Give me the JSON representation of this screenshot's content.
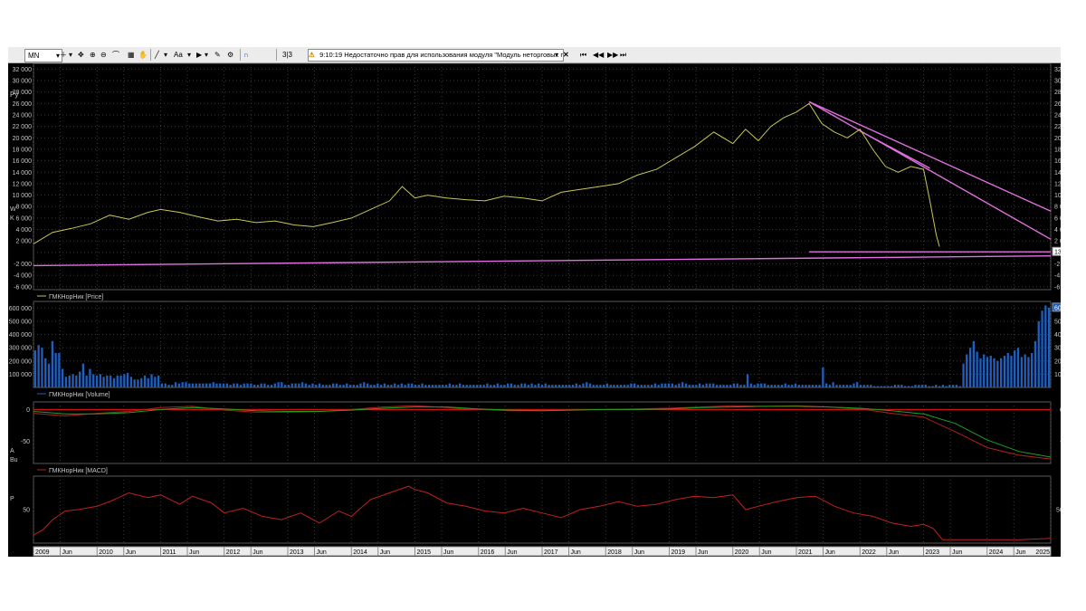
{
  "toolbar": {
    "timeframe": "MN",
    "counter": "3|3",
    "status_time": "9:10:19",
    "status_text": "Недостаточно прав для использования модуля \"Модуль неторговых п",
    "text_tool": "Aa"
  },
  "panes": {
    "price": {
      "legend": "ГМКНорНик [Price]",
      "left_label": "Ру",
      "last_value": "137,18"
    },
    "volume": {
      "legend": "ГМКНорНик [Volume]",
      "last_value": "60 282"
    },
    "macd": {
      "legend": "ГМКНорНик [MACD]"
    },
    "rsi": {
      "legend": "ГМКНорНик [RSI]"
    }
  },
  "time_axis": [
    {
      "label": "2009",
      "v": 2009.0
    },
    {
      "label": "Jun",
      "v": 2009.42
    },
    {
      "label": "2010",
      "v": 2010.0
    },
    {
      "label": "Jun",
      "v": 2010.42
    },
    {
      "label": "2011",
      "v": 2011.0
    },
    {
      "label": "Jun",
      "v": 2011.42
    },
    {
      "label": "2012",
      "v": 2012.0
    },
    {
      "label": "Jun",
      "v": 2012.42
    },
    {
      "label": "2013",
      "v": 2013.0
    },
    {
      "label": "Jun",
      "v": 2013.42
    },
    {
      "label": "2014",
      "v": 2014.0
    },
    {
      "label": "Jun",
      "v": 2014.42
    },
    {
      "label": "2015",
      "v": 2015.0
    },
    {
      "label": "Jun",
      "v": 2015.42
    },
    {
      "label": "2016",
      "v": 2016.0
    },
    {
      "label": "Jun",
      "v": 2016.42
    },
    {
      "label": "2017",
      "v": 2017.0
    },
    {
      "label": "Jun",
      "v": 2017.42
    },
    {
      "label": "2018",
      "v": 2018.0
    },
    {
      "label": "Jun",
      "v": 2018.42
    },
    {
      "label": "2019",
      "v": 2019.0
    },
    {
      "label": "Jun",
      "v": 2019.42
    },
    {
      "label": "2020",
      "v": 2020.0
    },
    {
      "label": "Jun",
      "v": 2020.42
    },
    {
      "label": "2021",
      "v": 2021.0
    },
    {
      "label": "Jun",
      "v": 2021.42
    },
    {
      "label": "2022",
      "v": 2022.0
    },
    {
      "label": "Jun",
      "v": 2022.42
    },
    {
      "label": "2023",
      "v": 2023.0
    },
    {
      "label": "Jun",
      "v": 2023.42
    },
    {
      "label": "2024",
      "v": 2024.0
    },
    {
      "label": "Jun",
      "v": 2024.42
    },
    {
      "label": "2025",
      "v": 2025.0
    }
  ],
  "axes": {
    "price_ticks": [
      "32 000",
      "30 000",
      "28 000",
      "26 000",
      "24 000",
      "22 000",
      "20 000",
      "18 000",
      "16 000",
      "14 000",
      "12 000",
      "10 000",
      "8 000",
      "6 000",
      "4 000",
      "2 000",
      "0",
      "-2 000",
      "-4 000",
      "-6 000"
    ],
    "price_values": [
      32000,
      30000,
      28000,
      26000,
      24000,
      22000,
      20000,
      18000,
      16000,
      14000,
      12000,
      10000,
      8000,
      6000,
      4000,
      2000,
      0,
      -2000,
      -4000,
      -6000
    ],
    "price_left_ticks": [
      "32 000",
      "30 000",
      "28 000",
      "26 000",
      "24 000",
      "22 000",
      "20 000",
      "18 000",
      "16 000",
      "14 000",
      "12 000",
      "10 000",
      "8 000",
      "6 000",
      "4 000",
      "2 000",
      "-2 000",
      "-4 000",
      "-6 000"
    ],
    "price_left_values": [
      32000,
      30000,
      28000,
      26000,
      24000,
      22000,
      20000,
      18000,
      16000,
      14000,
      12000,
      10000,
      8000,
      6000,
      4000,
      2000,
      -2000,
      -4000,
      -6000
    ],
    "volume_ticks": [
      "60 000",
      "50 000",
      "40 000",
      "30 000",
      "20 000",
      "10 000"
    ],
    "volume_values": [
      60000,
      50000,
      40000,
      30000,
      20000,
      10000
    ],
    "volume_left_ticks": [
      "600 000",
      "500 000",
      "400 000",
      "300 000",
      "200 000",
      "100 000"
    ],
    "macd_ticks": [
      "0",
      "-50"
    ],
    "macd_values": [
      0,
      -50
    ],
    "rsi_ticks": [
      "50"
    ],
    "rsi_values": [
      50
    ]
  },
  "colors": {
    "price_line": "#c8c850",
    "trendline": "#e070e0",
    "volume_bar": "#1f5fbf",
    "macd_line": "#b02020",
    "signal_line": "#20a020",
    "rsi_line": "#c02020",
    "zero_line": "#d01010"
  },
  "chart_data": [
    {
      "type": "line",
      "series": [
        {
          "name": "ГМКНорНик [Price]",
          "x": [
            2009.0,
            2009.3,
            2009.6,
            2009.9,
            2010.2,
            2010.5,
            2010.8,
            2011.0,
            2011.3,
            2011.6,
            2011.9,
            2012.2,
            2012.5,
            2012.8,
            2013.1,
            2013.4,
            2013.7,
            2014.0,
            2014.3,
            2014.6,
            2014.8,
            2015.0,
            2015.2,
            2015.5,
            2015.8,
            2016.1,
            2016.4,
            2016.7,
            2017.0,
            2017.3,
            2017.6,
            2017.9,
            2018.2,
            2018.5,
            2018.8,
            2019.1,
            2019.4,
            2019.7,
            2020.0,
            2020.2,
            2020.4,
            2020.6,
            2020.8,
            2021.0,
            2021.2,
            2021.4,
            2021.6,
            2021.8,
            2022.0,
            2022.2,
            2022.4,
            2022.6,
            2022.8,
            2023.0,
            2023.1,
            2023.2,
            2023.25
          ],
          "y": [
            1500,
            3500,
            4200,
            5000,
            6500,
            5800,
            7000,
            7500,
            7000,
            6200,
            5500,
            5800,
            5200,
            5500,
            4800,
            4500,
            5200,
            6000,
            7500,
            9000,
            11500,
            9500,
            10000,
            9500,
            9200,
            9000,
            9800,
            9500,
            9000,
            10500,
            11000,
            11500,
            12000,
            13500,
            14500,
            16500,
            18500,
            21000,
            19000,
            21500,
            19500,
            22000,
            23500,
            24500,
            26000,
            22500,
            21000,
            20000,
            21500,
            18000,
            15000,
            14000,
            15000,
            14500,
            9000,
            3000,
            1000
          ]
        }
      ],
      "xlim": [
        2009.0,
        2025.0
      ],
      "ylim": [
        -6500,
        33000
      ],
      "annotations": [
        {
          "type": "trendline",
          "from": [
            2021.2,
            26300
          ],
          "to": [
            2025.0,
            7200
          ]
        },
        {
          "type": "trendline",
          "from": [
            2021.2,
            26300
          ],
          "to": [
            2025.0,
            2300
          ]
        },
        {
          "type": "trendline",
          "from": [
            2022.0,
            21200
          ],
          "to": [
            2023.1,
            14700
          ]
        },
        {
          "type": "trendline",
          "from": [
            2009.0,
            -2300
          ],
          "to": [
            2025.0,
            -600
          ]
        },
        {
          "type": "hline",
          "from": [
            2021.2,
            100
          ],
          "to": [
            2025.0,
            100
          ]
        }
      ]
    },
    {
      "type": "bar",
      "series": [
        {
          "name": "ГМКНорНик [Volume]",
          "values": [
            28000,
            32000,
            30000,
            22000,
            18000,
            35000,
            26000,
            26000,
            14000,
            8000,
            9000,
            10000,
            9000,
            12000,
            18000,
            9000,
            14000,
            10000,
            9000,
            10000,
            8000,
            9000,
            9000,
            7000,
            9000,
            9000,
            10000,
            11000,
            8000,
            6000,
            6000,
            7000,
            9000,
            7000,
            10000,
            8000,
            9000,
            3000,
            3000,
            2000,
            2000,
            4000,
            3000,
            4000,
            4000,
            3000,
            3000,
            3000,
            3000,
            3000,
            3000,
            3000,
            4000,
            3000,
            3000,
            3000,
            3000,
            2000,
            3000,
            3000,
            2000,
            3000,
            3000,
            3000,
            2000,
            2000,
            3000,
            3000,
            2000,
            2000,
            3000,
            4000,
            4000,
            2000,
            2000,
            3000,
            3000,
            3000,
            4000,
            3000,
            2000,
            3000,
            2000,
            3000,
            2000,
            2000,
            2000,
            3000,
            3000,
            2000,
            2000,
            3000,
            2000,
            2000,
            2000,
            3000,
            4000,
            3000,
            2000,
            2000,
            3000,
            2000,
            3000,
            2000,
            2000,
            3000,
            2000,
            3000,
            2000,
            3000,
            3000,
            2000,
            2000,
            3000,
            2000,
            2000,
            2000,
            2000,
            2000,
            2000,
            2000,
            3000,
            2000,
            2000,
            3000,
            2000,
            2000,
            2000,
            2000,
            2000,
            2000,
            2000,
            3000,
            2000,
            2000,
            3000,
            2000,
            2000,
            3000,
            3000,
            2000,
            2000,
            3000,
            3000,
            2000,
            3000,
            2000,
            3000,
            2000,
            3000,
            2000,
            2000,
            2000,
            2000,
            2000,
            2000,
            2000,
            2000,
            3000,
            2000,
            3000,
            4000,
            3000,
            2000,
            2000,
            2000,
            2000,
            3000,
            2000,
            2000,
            2000,
            2000,
            2000,
            2000,
            3000,
            3000,
            2000,
            2000,
            2000,
            2000,
            2000,
            3000,
            2000,
            3000,
            3000,
            3000,
            3000,
            2000,
            3000,
            4000,
            3000,
            2000,
            2000,
            2000,
            3000,
            2000,
            3000,
            3000,
            3000,
            2000,
            2000,
            2000,
            2000,
            2000,
            3000,
            3000,
            2000,
            2000,
            10000,
            3000,
            2000,
            3000,
            3000,
            3000,
            2000,
            2000,
            2000,
            2000,
            2000,
            3000,
            2000,
            2000,
            3000,
            2000,
            2000,
            2000,
            2000,
            2000,
            2000,
            2000,
            15000,
            3000,
            2000,
            4000,
            2000,
            2000,
            2000,
            2000,
            2000,
            3000,
            4000,
            2000,
            2000,
            2000,
            2000,
            1000,
            1000,
            1000,
            1000,
            1000,
            1000,
            2000,
            2000,
            2000,
            1000,
            1000,
            1000,
            2000,
            2000,
            2000,
            2000,
            1000,
            1000,
            2000,
            1000,
            2000,
            1000,
            2000,
            2000,
            2000,
            1000,
            18000,
            25000,
            30000,
            35000,
            27000,
            22000,
            25000,
            23000,
            24000,
            22000,
            20000,
            22000,
            24000,
            26000,
            24000,
            28000,
            30000,
            23000,
            25000,
            23000,
            26000,
            35000,
            50000,
            58000,
            62000,
            60282
          ]
        }
      ],
      "ylim": [
        0,
        65000
      ]
    },
    {
      "type": "line",
      "series": [
        {
          "name": "MACD",
          "x": [
            2009.0,
            2009.5,
            2010.0,
            2010.5,
            2011.0,
            2011.5,
            2012.0,
            2012.5,
            2013.0,
            2013.5,
            2014.0,
            2014.5,
            2015.0,
            2015.5,
            2016.0,
            2016.5,
            2017.0,
            2017.5,
            2018.0,
            2018.5,
            2019.0,
            2019.5,
            2020.0,
            2020.5,
            2021.0,
            2021.5,
            2022.0,
            2022.5,
            2023.0,
            2023.5,
            2024.0,
            2024.5,
            2025.0
          ],
          "y": [
            -6,
            -10,
            -6,
            -3,
            3,
            5,
            -1,
            -4,
            -4,
            -3,
            0,
            4,
            6,
            3,
            0,
            -2,
            -2,
            0,
            0,
            1,
            2,
            4,
            6,
            5,
            6,
            4,
            1,
            -6,
            -12,
            -35,
            -60,
            -72,
            -78
          ]
        },
        {
          "name": "Signal",
          "x": [
            2009.0,
            2009.5,
            2010.0,
            2010.5,
            2011.0,
            2011.5,
            2012.0,
            2012.5,
            2013.0,
            2013.5,
            2014.0,
            2014.5,
            2015.0,
            2015.5,
            2016.0,
            2016.5,
            2017.0,
            2017.5,
            2018.0,
            2018.5,
            2019.0,
            2019.5,
            2020.0,
            2020.5,
            2021.0,
            2021.5,
            2022.0,
            2022.5,
            2023.0,
            2023.5,
            2024.0,
            2024.5,
            2025.0
          ],
          "y": [
            -3,
            -7,
            -7,
            -5,
            0,
            3,
            1,
            -2,
            -3,
            -3,
            -1,
            2,
            4,
            4,
            1,
            -1,
            -2,
            -1,
            0,
            0,
            1,
            3,
            4,
            5,
            5,
            4,
            2,
            -2,
            -7,
            -22,
            -48,
            -66,
            -75
          ]
        }
      ],
      "ylim": [
        -85,
        12
      ]
    },
    {
      "type": "line",
      "series": [
        {
          "name": "ГМКНорНик [RSI]",
          "x": [
            2009.0,
            2009.15,
            2009.3,
            2009.5,
            2009.7,
            2010.0,
            2010.2,
            2010.5,
            2010.8,
            2011.0,
            2011.3,
            2011.5,
            2011.8,
            2012.0,
            2012.3,
            2012.6,
            2012.9,
            2013.2,
            2013.5,
            2013.8,
            2014.0,
            2014.3,
            2014.6,
            2014.9,
            2015.0,
            2015.2,
            2015.5,
            2015.8,
            2016.1,
            2016.4,
            2016.7,
            2017.0,
            2017.3,
            2017.6,
            2017.9,
            2018.2,
            2018.5,
            2018.8,
            2019.1,
            2019.4,
            2019.7,
            2020.0,
            2020.2,
            2020.4,
            2020.7,
            2021.0,
            2021.3,
            2021.6,
            2021.9,
            2022.2,
            2022.5,
            2022.8,
            2023.0,
            2023.15,
            2023.3,
            2023.6,
            2024.0,
            2024.5,
            2025.0
          ],
          "y": [
            12,
            20,
            35,
            48,
            50,
            55,
            62,
            75,
            68,
            72,
            58,
            70,
            60,
            45,
            52,
            40,
            35,
            45,
            30,
            48,
            40,
            65,
            75,
            85,
            80,
            75,
            60,
            55,
            48,
            45,
            52,
            45,
            38,
            50,
            55,
            62,
            55,
            58,
            65,
            70,
            68,
            72,
            50,
            55,
            62,
            68,
            70,
            55,
            45,
            40,
            30,
            25,
            28,
            22,
            5,
            5,
            5,
            5,
            7
          ]
        }
      ],
      "ylim": [
        0,
        100
      ]
    }
  ]
}
